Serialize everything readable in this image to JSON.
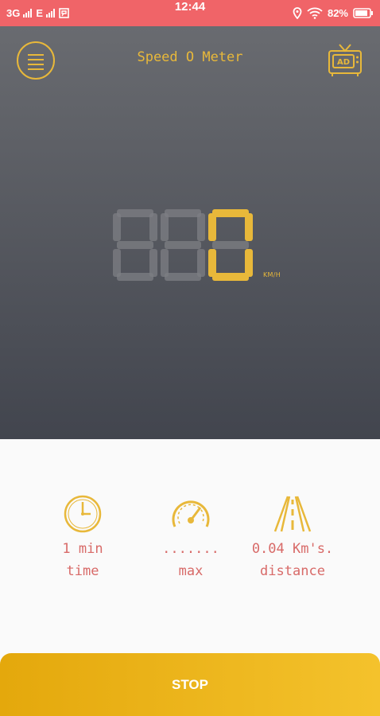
{
  "status_bar": {
    "network_1": "3G",
    "network_2": "E",
    "time": "12:44",
    "battery": "82%"
  },
  "header": {
    "title": "Speed O Meter",
    "ad_label": "AD"
  },
  "speedometer": {
    "speed_value": 0,
    "unit": "KM/H"
  },
  "stats": [
    {
      "icon": "clock-icon",
      "value": "1 min",
      "label": "time"
    },
    {
      "icon": "speedometer-icon",
      "value": ".......",
      "label": "max"
    },
    {
      "icon": "road-icon",
      "value": "0.04 Km's.",
      "label": "distance"
    }
  ],
  "stop_label": "STOP",
  "colors": {
    "accent": "#e8b83a",
    "status_bar": "#f06468",
    "text_red": "#d86a68",
    "button_start": "#e4a80c",
    "button_end": "#f4c22c"
  }
}
